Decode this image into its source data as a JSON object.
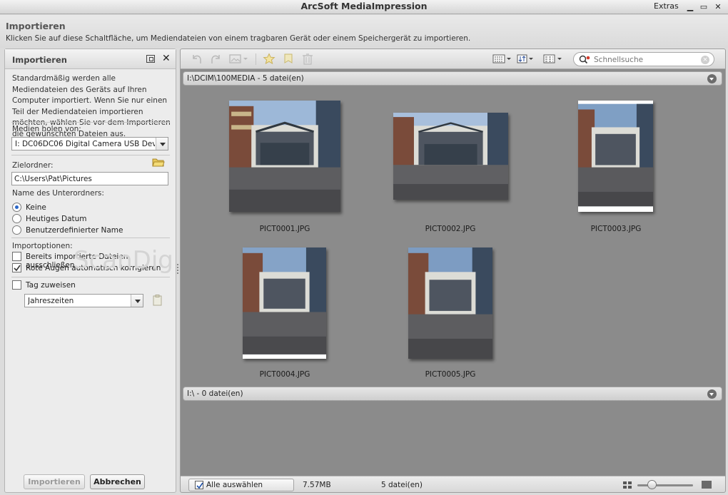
{
  "window": {
    "title": "ArcSoft MediaImpression",
    "menu_extras": "Extras",
    "minimize": "▁",
    "maximize": "▭",
    "close": "✕"
  },
  "header": {
    "title": "Importieren",
    "description": "Klicken Sie auf diese Schaltfläche, um Mediendateien von einem tragbaren Gerät oder einem Speichergerät zu importieren."
  },
  "left_panel": {
    "title": "Importieren",
    "close_glyph": "✕",
    "intro": "Standardmäßig werden alle Mediendateien des Geräts auf Ihren Computer importiert. Wenn Sie nur einen Teil der Mediendateien importieren möchten, wählen Sie vor dem Importieren die gewünschten Dateien aus.",
    "source_label": "Medien holen von:",
    "source_value": "I: DC06DC06  Digital Camera USB Dev...",
    "target_label": "Zielordner:",
    "target_value": "C:\\Users\\Pat\\Pictures",
    "subfolder_label": "Name des Unterordners:",
    "subfolder_options": [
      {
        "label": "Keine",
        "selected": true
      },
      {
        "label": "Heutiges Datum",
        "selected": false
      },
      {
        "label": "Benutzerdefinierter Name",
        "selected": false
      }
    ],
    "import_options_label": "Importoptionen:",
    "option_exclude": {
      "label": "Bereits importierte Dateien ausschließen",
      "checked": false
    },
    "option_redeye": {
      "label": "Rote Augen automatisch korrigieren",
      "checked": true
    },
    "tag_assign": {
      "label": "Tag zuweisen",
      "checked": false
    },
    "tag_value": "Jahreszeiten",
    "import_button": "Importieren",
    "cancel_button": "Abbrechen"
  },
  "watermark": "ScanDig",
  "toolbar": {
    "search_placeholder": "Schnellsuche",
    "icons": [
      "rotate-left-icon",
      "rotate-right-icon",
      "image-menu-icon",
      "star-icon",
      "tag-icon",
      "trash-icon",
      "view-mode-icon",
      "sort-icon",
      "grid-layout-icon",
      "search-icon"
    ]
  },
  "groups": [
    {
      "path": "I:\\DCIM\\100MEDIA - 5 datei(en)"
    },
    {
      "path": "I:\\ - 0 datei(en)"
    }
  ],
  "thumbnails": [
    {
      "filename": "PICT0001.JPG"
    },
    {
      "filename": "PICT0002.JPG"
    },
    {
      "filename": "PICT0003.JPG"
    },
    {
      "filename": "PICT0004.JPG"
    },
    {
      "filename": "PICT0005.JPG"
    }
  ],
  "statusbar": {
    "select_all": "Alle auswählen",
    "select_all_checked": true,
    "total_size": "7.57MB",
    "file_count": "5 datei(en)",
    "zoom_level": 0.22
  },
  "colors": {
    "content_bg": "#8b8b8b",
    "accent": "#2a66c8"
  }
}
